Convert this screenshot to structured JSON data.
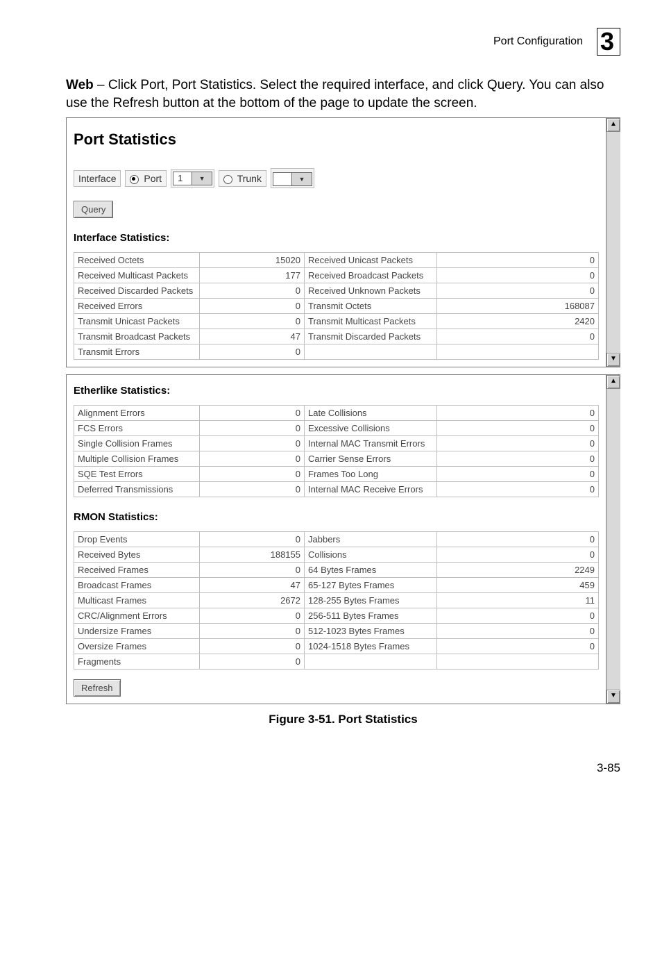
{
  "header": {
    "section": "Port Configuration",
    "chapter": "3"
  },
  "intro": {
    "bold": "Web",
    "text": " – Click Port, Port Statistics. Select the required interface, and click Query. You can also use the Refresh button at the bottom of the page to update the screen."
  },
  "panel1": {
    "title": "Port Statistics",
    "interfaceLabel": "Interface",
    "portLabel": "Port",
    "portValue": "1",
    "trunkLabel": "Trunk",
    "trunkValue": "",
    "queryBtn": "Query",
    "ifaceStatsHead": "Interface Statistics:",
    "rows": [
      {
        "l1": "Received Octets",
        "v1": "15020",
        "l2": "Received Unicast Packets",
        "v2": "0"
      },
      {
        "l1": "Received Multicast Packets",
        "v1": "177",
        "l2": "Received Broadcast Packets",
        "v2": "0"
      },
      {
        "l1": "Received Discarded Packets",
        "v1": "0",
        "l2": "Received Unknown Packets",
        "v2": "0"
      },
      {
        "l1": "Received Errors",
        "v1": "0",
        "l2": "Transmit Octets",
        "v2": "168087"
      },
      {
        "l1": "Transmit Unicast Packets",
        "v1": "0",
        "l2": "Transmit Multicast Packets",
        "v2": "2420"
      },
      {
        "l1": "Transmit Broadcast Packets",
        "v1": "47",
        "l2": "Transmit Discarded Packets",
        "v2": "0"
      },
      {
        "l1": "Transmit Errors",
        "v1": "0",
        "l2": "",
        "v2": ""
      }
    ]
  },
  "panel2": {
    "etherHead": "Etherlike Statistics:",
    "etherRows": [
      {
        "l1": "Alignment Errors",
        "v1": "0",
        "l2": "Late Collisions",
        "v2": "0"
      },
      {
        "l1": "FCS Errors",
        "v1": "0",
        "l2": "Excessive Collisions",
        "v2": "0"
      },
      {
        "l1": "Single Collision Frames",
        "v1": "0",
        "l2": "Internal MAC Transmit Errors",
        "v2": "0"
      },
      {
        "l1": "Multiple Collision Frames",
        "v1": "0",
        "l2": "Carrier Sense Errors",
        "v2": "0"
      },
      {
        "l1": "SQE Test Errors",
        "v1": "0",
        "l2": "Frames Too Long",
        "v2": "0"
      },
      {
        "l1": "Deferred Transmissions",
        "v1": "0",
        "l2": "Internal MAC Receive Errors",
        "v2": "0"
      }
    ],
    "rmonHead": "RMON Statistics:",
    "rmonRows": [
      {
        "l1": "Drop Events",
        "v1": "0",
        "l2": "Jabbers",
        "v2": "0"
      },
      {
        "l1": "Received Bytes",
        "v1": "188155",
        "l2": "Collisions",
        "v2": "0"
      },
      {
        "l1": "Received Frames",
        "v1": "0",
        "l2": "64 Bytes Frames",
        "v2": "2249"
      },
      {
        "l1": "Broadcast Frames",
        "v1": "47",
        "l2": "65-127 Bytes Frames",
        "v2": "459"
      },
      {
        "l1": "Multicast Frames",
        "v1": "2672",
        "l2": "128-255 Bytes Frames",
        "v2": "11"
      },
      {
        "l1": "CRC/Alignment Errors",
        "v1": "0",
        "l2": "256-511 Bytes Frames",
        "v2": "0"
      },
      {
        "l1": "Undersize Frames",
        "v1": "0",
        "l2": "512-1023 Bytes Frames",
        "v2": "0"
      },
      {
        "l1": "Oversize Frames",
        "v1": "0",
        "l2": "1024-1518 Bytes Frames",
        "v2": "0"
      },
      {
        "l1": "Fragments",
        "v1": "0",
        "l2": "",
        "v2": ""
      }
    ],
    "refreshBtn": "Refresh"
  },
  "caption": "Figure 3-51.  Port Statistics",
  "pageNumber": "3-85"
}
